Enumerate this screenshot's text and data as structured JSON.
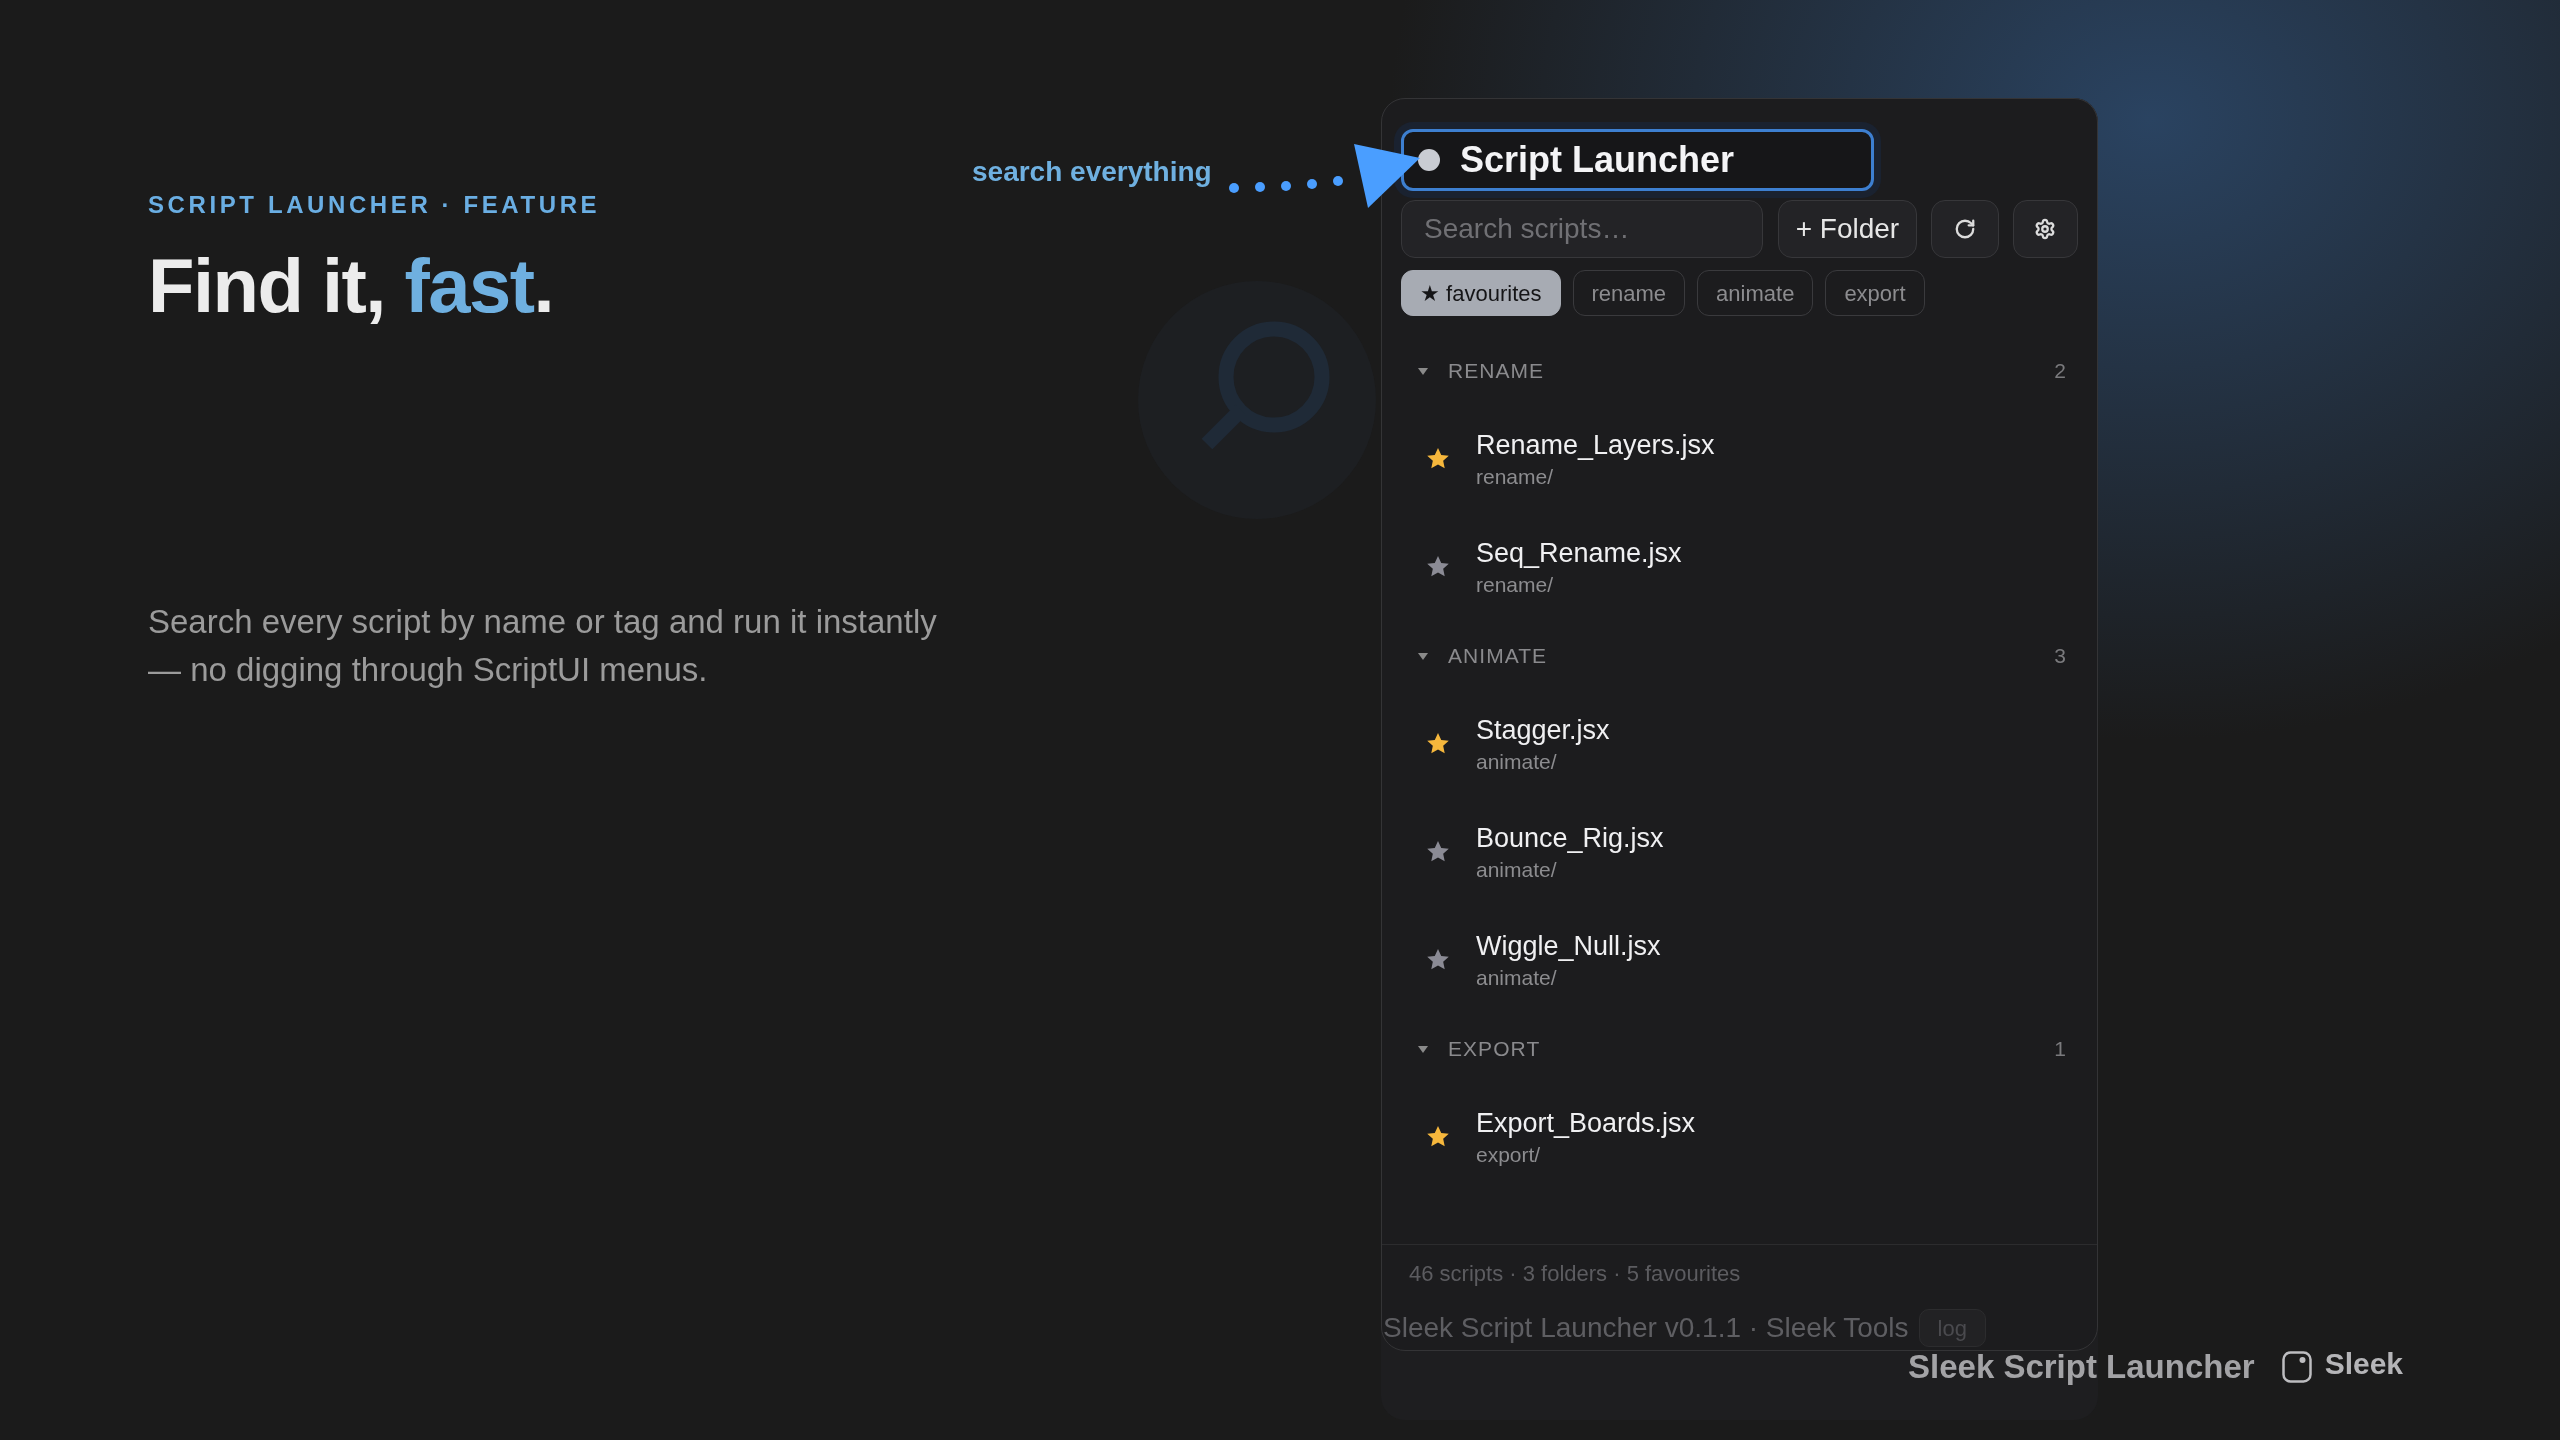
{
  "eyebrow": "SCRIPT LAUNCHER · FEATURE",
  "headline": {
    "lead": "Find it,",
    "accent": "fast",
    "tail": "."
  },
  "description": "Search every script by name or tag and run it instantly — no digging through ScriptUI menus.",
  "callout": {
    "label": "search everything"
  },
  "panel": {
    "title": "Script Launcher",
    "search": {
      "placeholder": "Search scripts…"
    },
    "folder_button": "+ Folder",
    "chips": [
      {
        "label": "★ favourites",
        "selected": true
      },
      {
        "label": "rename",
        "selected": false
      },
      {
        "label": "animate",
        "selected": false
      },
      {
        "label": "export",
        "selected": false
      }
    ],
    "groups": [
      {
        "name": "RENAME",
        "count": "2",
        "expanded": true,
        "scripts": [
          {
            "name": "Rename_Layers.jsx",
            "path": "rename/",
            "favourite": true
          },
          {
            "name": "Seq_Rename.jsx",
            "path": "rename/",
            "favourite": false
          }
        ]
      },
      {
        "name": "ANIMATE",
        "count": "3",
        "expanded": true,
        "scripts": [
          {
            "name": "Stagger.jsx",
            "path": "animate/",
            "favourite": true
          },
          {
            "name": "Bounce_Rig.jsx",
            "path": "animate/",
            "favourite": false
          },
          {
            "name": "Wiggle_Null.jsx",
            "path": "animate/",
            "favourite": false
          }
        ]
      },
      {
        "name": "EXPORT",
        "count": "1",
        "expanded": true,
        "scripts": [
          {
            "name": "Export_Boards.jsx",
            "path": "export/",
            "favourite": true
          }
        ]
      }
    ],
    "status": "46 scripts · 3 folders · 5 favourites",
    "footer": {
      "credit": "Sleek Script Launcher v0.1.1 · Sleek Tools",
      "log_button": "log"
    }
  },
  "brand": {
    "product": "Sleek Script Launcher",
    "logo_text": "Sleek"
  }
}
